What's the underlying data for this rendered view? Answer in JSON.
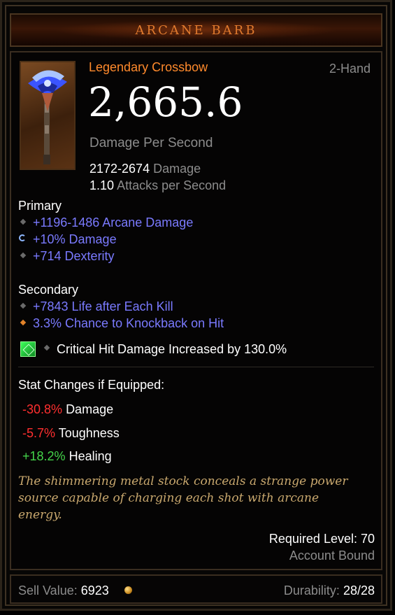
{
  "item": {
    "name": "ARCANE BARB",
    "type": "Legendary Crossbow",
    "slot": "2-Hand",
    "dps": "2,665.6",
    "dps_label": "Damage Per Second",
    "damage_range": "2172-2674",
    "damage_label": "Damage",
    "attack_speed": "1.10",
    "attack_speed_label": "Attacks per Second"
  },
  "primary": {
    "heading": "Primary",
    "stats": [
      "+1196-1486 Arcane Damage",
      "+10% Damage",
      "+714 Dexterity"
    ]
  },
  "secondary": {
    "heading": "Secondary",
    "stats": [
      "+7843 Life after Each Kill",
      "3.3% Chance to Knockback on Hit"
    ]
  },
  "socket": {
    "gem_icon": "emerald-gem-icon",
    "text": "Critical Hit Damage Increased by 130.0%"
  },
  "stat_changes": {
    "heading": "Stat Changes if Equipped:",
    "rows": [
      {
        "value": "-30.8%",
        "label": "Damage"
      },
      {
        "value": "-5.7%",
        "label": "Toughness"
      },
      {
        "value": "+18.2%",
        "label": "Healing"
      }
    ]
  },
  "flavor": {
    "lines": [
      "The shimmering metal stock conceals a strange power",
      "source capable of charging each shot with arcane",
      "energy."
    ]
  },
  "requirements": {
    "level": "Required Level: 70",
    "binding": "Account Bound"
  },
  "footer": {
    "sell_label": "Sell Value:",
    "sell_value": "6923",
    "durability_label": "Durability:",
    "durability_value": "28/28"
  },
  "colors": {
    "title": "#e07a2e",
    "legendary": "#ff8a2c",
    "magic_affix": "#7a7aff",
    "negative": "#ff2f2f",
    "positive": "#44d44a",
    "flavor": "#c9a86e"
  }
}
